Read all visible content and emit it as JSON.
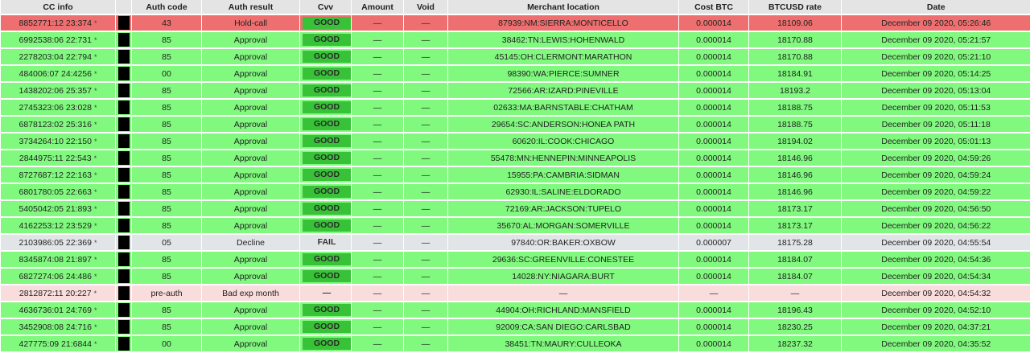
{
  "columns": [
    {
      "key": "cc_info",
      "label": "CC info"
    },
    {
      "key": "mask",
      "label": ""
    },
    {
      "key": "auth_code",
      "label": "Auth code"
    },
    {
      "key": "auth_result",
      "label": "Auth result"
    },
    {
      "key": "cvv",
      "label": "Cvv"
    },
    {
      "key": "amount",
      "label": "Amount"
    },
    {
      "key": "void",
      "label": "Void"
    },
    {
      "key": "merchant",
      "label": "Merchant location"
    },
    {
      "key": "cost_btc",
      "label": "Cost BTC"
    },
    {
      "key": "btcusd",
      "label": "BTCUSD rate"
    },
    {
      "key": "date",
      "label": "Date"
    }
  ],
  "status_colors": {
    "red": "#ee6f6f",
    "green": "#80f97e",
    "gray": "#e2e5e7",
    "pink": "#f9dcdc",
    "cvv_good": "#38c238"
  },
  "rows": [
    {
      "status": "red",
      "cc_info": "8852771:12 23:374",
      "star": "*",
      "auth_code": "43",
      "auth_result": "Hold-call",
      "cvv": "GOOD",
      "cvv_state": "good",
      "amount": "—",
      "void": "—",
      "merchant": "87939:NM:SIERRA:MONTICELLO",
      "cost_btc": "0.000014",
      "btcusd": "18109.06",
      "date": "December 09 2020, 05:26:46"
    },
    {
      "status": "green",
      "cc_info": "6992538:06 22:731",
      "star": "*",
      "auth_code": "85",
      "auth_result": "Approval",
      "cvv": "GOOD",
      "cvv_state": "good",
      "amount": "—",
      "void": "—",
      "merchant": "38462:TN:LEWIS:HOHENWALD",
      "cost_btc": "0.000014",
      "btcusd": "18170.88",
      "date": "December 09 2020, 05:21:57"
    },
    {
      "status": "green",
      "cc_info": "2278203:04 22:794",
      "star": "*",
      "auth_code": "85",
      "auth_result": "Approval",
      "cvv": "GOOD",
      "cvv_state": "good",
      "amount": "—",
      "void": "—",
      "merchant": "45145:OH:CLERMONT:MARATHON",
      "cost_btc": "0.000014",
      "btcusd": "18170.88",
      "date": "December 09 2020, 05:21:10"
    },
    {
      "status": "green",
      "cc_info": "484006:07 24:4256",
      "star": "*",
      "auth_code": "00",
      "auth_result": "Approval",
      "cvv": "GOOD",
      "cvv_state": "good",
      "amount": "—",
      "void": "—",
      "merchant": "98390:WA:PIERCE:SUMNER",
      "cost_btc": "0.000014",
      "btcusd": "18184.91",
      "date": "December 09 2020, 05:14:25"
    },
    {
      "status": "green",
      "cc_info": "1438202:06 25:357",
      "star": "*",
      "auth_code": "85",
      "auth_result": "Approval",
      "cvv": "GOOD",
      "cvv_state": "good",
      "amount": "—",
      "void": "—",
      "merchant": "72566:AR:IZARD:PINEVILLE",
      "cost_btc": "0.000014",
      "btcusd": "18193.2",
      "date": "December 09 2020, 05:13:04"
    },
    {
      "status": "green",
      "cc_info": "2745323:06 23:028",
      "star": "*",
      "auth_code": "85",
      "auth_result": "Approval",
      "cvv": "GOOD",
      "cvv_state": "good",
      "amount": "—",
      "void": "—",
      "merchant": "02633:MA:BARNSTABLE:CHATHAM",
      "cost_btc": "0.000014",
      "btcusd": "18188.75",
      "date": "December 09 2020, 05:11:53"
    },
    {
      "status": "green",
      "cc_info": "6878123:02 25:316",
      "star": "*",
      "auth_code": "85",
      "auth_result": "Approval",
      "cvv": "GOOD",
      "cvv_state": "good",
      "amount": "—",
      "void": "—",
      "merchant": "29654:SC:ANDERSON:HONEA PATH",
      "cost_btc": "0.000014",
      "btcusd": "18188.75",
      "date": "December 09 2020, 05:11:18"
    },
    {
      "status": "green",
      "cc_info": "3734264:10 22:150",
      "star": "*",
      "auth_code": "85",
      "auth_result": "Approval",
      "cvv": "GOOD",
      "cvv_state": "good",
      "amount": "—",
      "void": "—",
      "merchant": "60620:IL:COOK:CHICAGO",
      "cost_btc": "0.000014",
      "btcusd": "18194.02",
      "date": "December 09 2020, 05:01:13"
    },
    {
      "status": "green",
      "cc_info": "2844975:11 22:543",
      "star": "*",
      "auth_code": "85",
      "auth_result": "Approval",
      "cvv": "GOOD",
      "cvv_state": "good",
      "amount": "—",
      "void": "—",
      "merchant": "55478:MN:HENNEPIN:MINNEAPOLIS",
      "cost_btc": "0.000014",
      "btcusd": "18146.96",
      "date": "December 09 2020, 04:59:26"
    },
    {
      "status": "green",
      "cc_info": "8727687:12 22:163",
      "star": "*",
      "auth_code": "85",
      "auth_result": "Approval",
      "cvv": "GOOD",
      "cvv_state": "good",
      "amount": "—",
      "void": "—",
      "merchant": "15955:PA:CAMBRIA:SIDMAN",
      "cost_btc": "0.000014",
      "btcusd": "18146.96",
      "date": "December 09 2020, 04:59:24"
    },
    {
      "status": "green",
      "cc_info": "6801780:05 22:663",
      "star": "*",
      "auth_code": "85",
      "auth_result": "Approval",
      "cvv": "GOOD",
      "cvv_state": "good",
      "amount": "—",
      "void": "—",
      "merchant": "62930:IL:SALINE:ELDORADO",
      "cost_btc": "0.000014",
      "btcusd": "18146.96",
      "date": "December 09 2020, 04:59:22"
    },
    {
      "status": "green",
      "cc_info": "5405042:05 21:893",
      "star": "*",
      "auth_code": "85",
      "auth_result": "Approval",
      "cvv": "GOOD",
      "cvv_state": "good",
      "amount": "—",
      "void": "—",
      "merchant": "72169:AR:JACKSON:TUPELO",
      "cost_btc": "0.000014",
      "btcusd": "18173.17",
      "date": "December 09 2020, 04:56:50"
    },
    {
      "status": "green",
      "cc_info": "4162253:12 23:529",
      "star": "*",
      "auth_code": "85",
      "auth_result": "Approval",
      "cvv": "GOOD",
      "cvv_state": "good",
      "amount": "—",
      "void": "—",
      "merchant": "35670:AL:MORGAN:SOMERVILLE",
      "cost_btc": "0.000014",
      "btcusd": "18173.17",
      "date": "December 09 2020, 04:56:22"
    },
    {
      "status": "gray",
      "cc_info": "2103986:05 22:369",
      "star": "*",
      "auth_code": "05",
      "auth_result": "Decline",
      "cvv": "FAIL",
      "cvv_state": "fail",
      "amount": "—",
      "void": "—",
      "merchant": "97840:OR:BAKER:OXBOW",
      "cost_btc": "0.000007",
      "btcusd": "18175.28",
      "date": "December 09 2020, 04:55:54"
    },
    {
      "status": "green",
      "cc_info": "8345874:08 21:897",
      "star": "*",
      "auth_code": "85",
      "auth_result": "Approval",
      "cvv": "GOOD",
      "cvv_state": "good",
      "amount": "—",
      "void": "—",
      "merchant": "29636:SC:GREENVILLE:CONESTEE",
      "cost_btc": "0.000014",
      "btcusd": "18184.07",
      "date": "December 09 2020, 04:54:36"
    },
    {
      "status": "green",
      "cc_info": "6827274:06 24:486",
      "star": "*",
      "auth_code": "85",
      "auth_result": "Approval",
      "cvv": "GOOD",
      "cvv_state": "good",
      "amount": "—",
      "void": "—",
      "merchant": "14028:NY:NIAGARA:BURT",
      "cost_btc": "0.000014",
      "btcusd": "18184.07",
      "date": "December 09 2020, 04:54:34"
    },
    {
      "status": "pink",
      "cc_info": "2812872:11 20:227",
      "star": "*",
      "auth_code": "pre-auth",
      "auth_result": "Bad exp month",
      "cvv": "—",
      "cvv_state": "none",
      "amount": "—",
      "void": "—",
      "merchant": "—",
      "cost_btc": "—",
      "btcusd": "—",
      "date": "December 09 2020, 04:54:32"
    },
    {
      "status": "green",
      "cc_info": "4636736:01 24:769",
      "star": "*",
      "auth_code": "85",
      "auth_result": "Approval",
      "cvv": "GOOD",
      "cvv_state": "good",
      "amount": "—",
      "void": "—",
      "merchant": "44904:OH:RICHLAND:MANSFIELD",
      "cost_btc": "0.000014",
      "btcusd": "18196.43",
      "date": "December 09 2020, 04:52:10"
    },
    {
      "status": "green",
      "cc_info": "3452908:08 24:716",
      "star": "*",
      "auth_code": "85",
      "auth_result": "Approval",
      "cvv": "GOOD",
      "cvv_state": "good",
      "amount": "—",
      "void": "—",
      "merchant": "92009:CA:SAN DIEGO:CARLSBAD",
      "cost_btc": "0.000014",
      "btcusd": "18230.25",
      "date": "December 09 2020, 04:37:21"
    },
    {
      "status": "green",
      "cc_info": "427775:09 21:6844",
      "star": "*",
      "auth_code": "00",
      "auth_result": "Approval",
      "cvv": "GOOD",
      "cvv_state": "good",
      "amount": "—",
      "void": "—",
      "merchant": "38451:TN:MAURY:CULLEOKA",
      "cost_btc": "0.000014",
      "btcusd": "18237.32",
      "date": "December 09 2020, 04:35:52"
    }
  ]
}
